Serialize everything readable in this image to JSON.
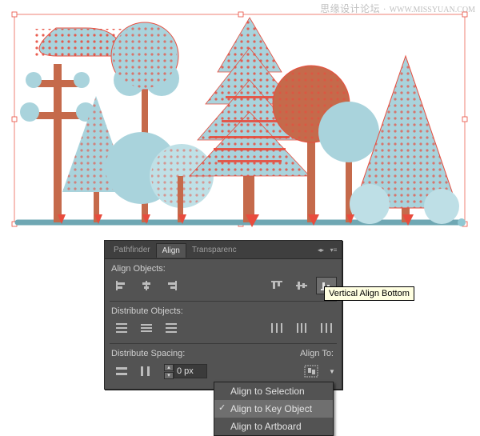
{
  "watermark": {
    "cn": "思缘设计论坛",
    "sep": "·",
    "en": "WWW.MISSYUAN.COM"
  },
  "tabs": {
    "pathfinder": "Pathfinder",
    "align": "Align",
    "transparency": "Transparenc"
  },
  "labels": {
    "align_objects": "Align Objects:",
    "distribute_objects": "Distribute Objects:",
    "distribute_spacing": "Distribute Spacing:",
    "align_to": "Align To:"
  },
  "spacing": {
    "value": "0 px"
  },
  "tooltip": "Vertical Align Bottom",
  "menu": {
    "selection": "Align to Selection",
    "key_object": "Align to Key Object",
    "artboard": "Align to Artboard"
  },
  "chart_data": null
}
